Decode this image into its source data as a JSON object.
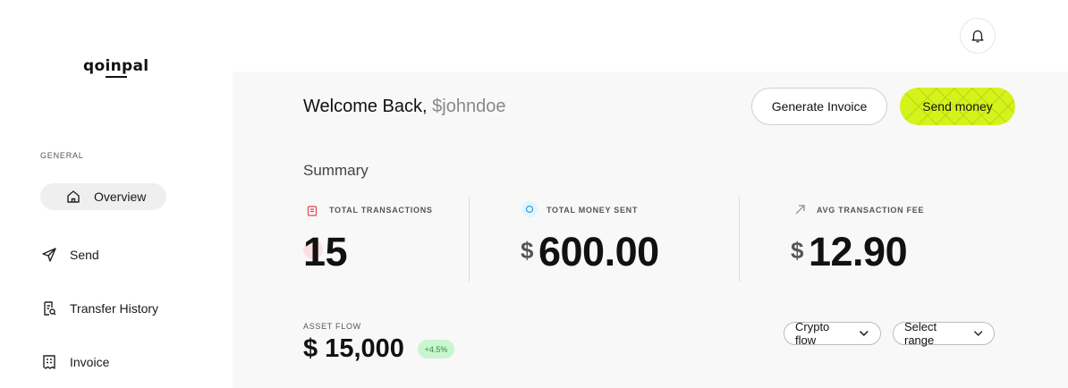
{
  "sidebar": {
    "logo": "qoinpal",
    "section_label": "GENERAL",
    "items": [
      {
        "label": "Overview",
        "icon": "home-icon",
        "active": true
      },
      {
        "label": "Send",
        "icon": "send-icon"
      },
      {
        "label": "Transfer History",
        "icon": "history-icon"
      },
      {
        "label": "Invoice",
        "icon": "invoice-icon"
      }
    ]
  },
  "header": {
    "icon": "bell-icon",
    "welcome": "Welcome Back,",
    "username": "$johndoe",
    "generate_invoice_label": "Generate Invoice",
    "send_money_label": "Send money"
  },
  "summary": {
    "title": "Summary",
    "stats": [
      {
        "label": "TOTAL TRANSACTIONS",
        "value": "15",
        "icon": "receipt-icon",
        "icon_color": "#e0454f"
      },
      {
        "label": "TOTAL MONEY SENT",
        "currency": "$",
        "value": "600.00",
        "icon": "circle-icon",
        "icon_color": "#2ba8e0"
      },
      {
        "label": "AVG TRANSACTION FEE",
        "currency": "$",
        "value": "12.90",
        "icon": "arrow-up-right-icon",
        "icon_color": "#888888"
      }
    ]
  },
  "asset_flow": {
    "label": "ASSET FLOW",
    "value": "$ 15,000",
    "change": "+4.5%",
    "crypto_select": "Crypto flow",
    "range_select": "Select range"
  },
  "colors": {
    "accent": "#d4f31a",
    "background": "#f8f8f8",
    "badge_bg": "#c9f5cf",
    "badge_text": "#2f8f3a"
  }
}
